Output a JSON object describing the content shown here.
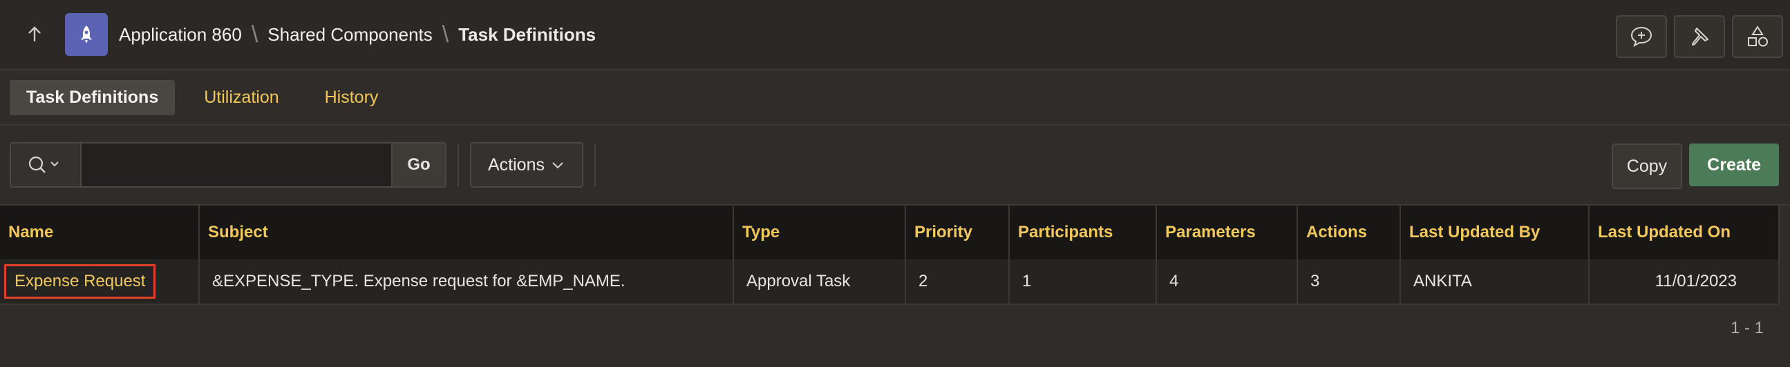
{
  "header": {
    "breadcrumbs": [
      "Application 860",
      "Shared Components",
      "Task Definitions"
    ],
    "icons": [
      "arrow-up-icon",
      "rocket-icon",
      "comment-add-icon",
      "pin-icon",
      "shapes-icon"
    ]
  },
  "tabs": [
    {
      "label": "Task Definitions",
      "active": true
    },
    {
      "label": "Utilization",
      "active": false
    },
    {
      "label": "History",
      "active": false
    }
  ],
  "toolbar": {
    "search_value": "",
    "go_label": "Go",
    "actions_label": "Actions",
    "copy_label": "Copy",
    "create_label": "Create"
  },
  "table": {
    "columns": [
      "Name",
      "Subject",
      "Type",
      "Priority",
      "Participants",
      "Parameters",
      "Actions",
      "Last Updated By",
      "Last Updated On"
    ],
    "rows": [
      {
        "name": "Expense Request",
        "subject": "&EXPENSE_TYPE. Expense request for &EMP_NAME.",
        "type": "Approval Task",
        "priority": "2",
        "participants": "1",
        "parameters": "4",
        "actions": "3",
        "last_updated_by": "ANKITA",
        "last_updated_on": "11/01/2023"
      }
    ]
  },
  "pagination": "1 - 1",
  "colors": {
    "accent": "#f3c85a",
    "create": "#4c7c57",
    "highlight": "#e2402a",
    "app_icon": "#5d63b4"
  }
}
